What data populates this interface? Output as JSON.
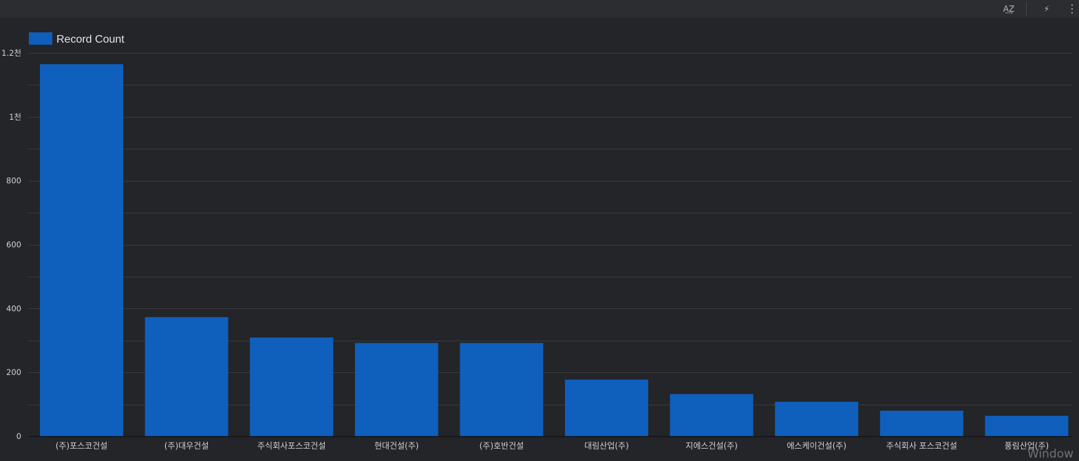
{
  "toolbar": {
    "sort_icon": "az-sort-icon",
    "sort_label": "A͢Z",
    "insights_icon": "lightning-bolt-icon",
    "insights_label": "⚡",
    "menu_icon": "vertical-ellipsis-icon",
    "menu_label": "⋮"
  },
  "watermark": "Window",
  "colors": {
    "background": "#232528",
    "toolbar": "#2b2d30",
    "bar": "#0f5fbd",
    "grid": "#3a3c40",
    "text": "#d0d2d4"
  },
  "chart_data": {
    "type": "bar",
    "legend_position": "top-left",
    "grid": true,
    "categories": [
      "(주)포스코건설",
      "(주)대우건설",
      "주식회사포스코건설",
      "현대건설(주)",
      "(주)호반건설",
      "대림산업(주)",
      "지에스건설(주)",
      "에스케이건설(주)",
      "주식회사 포스코건설",
      "풍림산업(주)"
    ],
    "series": [
      {
        "name": "Record Count",
        "values": [
          1165,
          373,
          309,
          292,
          292,
          177,
          132,
          108,
          80,
          64
        ]
      }
    ],
    "yticks": [
      {
        "value": 0,
        "label": "0"
      },
      {
        "value": 200,
        "label": "200"
      },
      {
        "value": 400,
        "label": "400"
      },
      {
        "value": 600,
        "label": "600"
      },
      {
        "value": 800,
        "label": "800"
      },
      {
        "value": 1000,
        "label": "1천"
      },
      {
        "value": 1200,
        "label": "1.2천"
      }
    ],
    "ylim": [
      0,
      1200
    ]
  }
}
